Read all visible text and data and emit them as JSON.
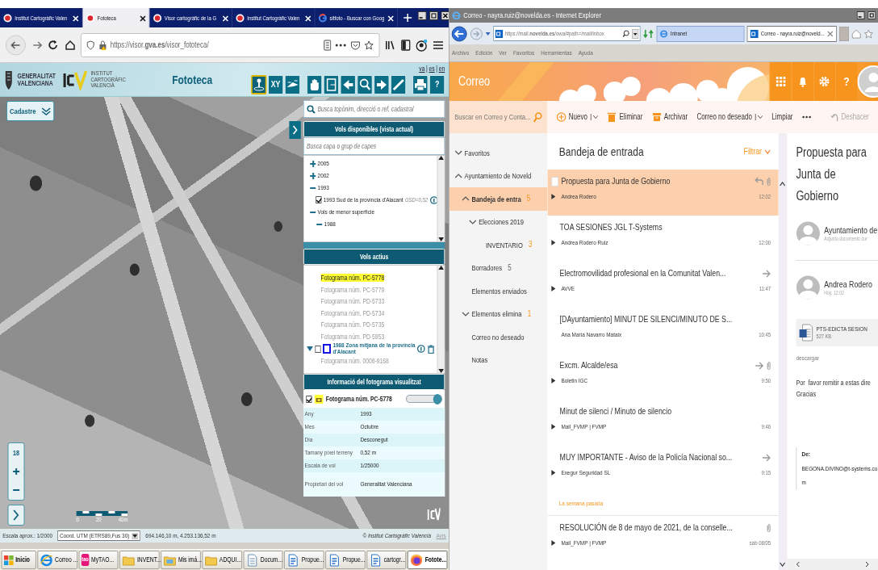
{
  "firefox": {
    "tabs": [
      {
        "title": "Institut Cartogràfic Valen",
        "selected": false
      },
      {
        "title": "Fototeca",
        "selected": true
      },
      {
        "title": "Visor cartogràfic de la G",
        "selected": false
      },
      {
        "title": "Institut Cartogràfic Valen",
        "selected": false
      },
      {
        "title": "sitfoto - Buscar con Goog",
        "selected": false
      }
    ],
    "url": "https://visor.**gva.es**/visor_fototeca/"
  },
  "visor": {
    "agency": "GENERALITAT VALENCIANA",
    "institute": "INSTITUT CARTOGRÀFIC VALENCIÀ",
    "title": "Fototeca",
    "languages": [
      "va",
      "es",
      "en"
    ],
    "language_separator": "|",
    "tools": [
      {
        "kind": "pin",
        "selected": true
      },
      {
        "kind": "xy",
        "label": "XY",
        "selected": false
      },
      {
        "kind": "plane",
        "selected": false
      },
      {
        "kind": "hand",
        "selected": false,
        "group_start": true
      },
      {
        "kind": "door",
        "selected": false
      },
      {
        "kind": "back",
        "selected": false
      },
      {
        "kind": "zoom",
        "selected": false
      },
      {
        "kind": "forward",
        "selected": false
      },
      {
        "kind": "ruler",
        "selected": false
      },
      {
        "kind": "print",
        "selected": false,
        "group_start": true
      },
      {
        "kind": "help",
        "label": "?",
        "selected": false
      }
    ],
    "basemap": "Cadastre",
    "search_placeholder": "Busca topònim, direcció o ref. cadastral",
    "layers": {
      "title": "Vols disponibles (vista actual)",
      "placeholder": "Busca capa o grup de capes",
      "tree": [
        {
          "label": "2005",
          "expanded": false
        },
        {
          "label": "2002",
          "expanded": false
        },
        {
          "label": "1993",
          "expanded": true,
          "children": [
            {
              "label": "1993 Sud de la província d'Alacant",
              "checked": true,
              "gsd": "GSD=0,52"
            }
          ]
        },
        {
          "label": "Vols de menor superfície",
          "expanded": true,
          "children": [
            {
              "label": "1988",
              "expanded": true
            }
          ]
        }
      ]
    },
    "active": {
      "title": "Vols actius",
      "photos": [
        {
          "label": "Fotograma núm. PC-5778",
          "selected": true
        },
        {
          "label": "Fotograma núm. PC-5779",
          "selected": false
        },
        {
          "label": "Fotograma núm. PD-5733",
          "selected": false
        },
        {
          "label": "Fotograma núm. PD-5734",
          "selected": false
        },
        {
          "label": "Fotograma núm. PD-5735",
          "selected": false
        },
        {
          "label": "Fotograma núm. PD-5953",
          "selected": false
        }
      ],
      "group": {
        "label": "1988 Zona mitjana de la província d'Alacant",
        "expanded": true,
        "checked": false,
        "photos": [
          {
            "label": "Fotograma núm. 0008-9168",
            "selected": false
          }
        ]
      }
    },
    "info": {
      "title": "Informació del fotograma visualitzat",
      "photo": "Fotograma núm. PC-5778",
      "checked": true,
      "opacity": {
        "level": 1
      },
      "rows": [
        {
          "label": "Any",
          "value": "1993"
        },
        {
          "label": "Mes",
          "value": "Octubre"
        },
        {
          "label": "Dia",
          "value": "Desconegut"
        },
        {
          "label": "Tamany píxel terreny",
          "value": "0,52 m"
        },
        {
          "label": "Escala de vol",
          "value": "1/25000"
        },
        {
          "label": "Propietari del vol",
          "value": "Generalitat Valenciana"
        }
      ]
    },
    "zoom_level": "18",
    "scale_bar": [
      "0",
      "20",
      "40m"
    ],
    "status": {
      "scale": "Escala aprox.: 1/2000",
      "coord_system": "Coord. UTM (ETRS89,Fus 30)",
      "coords": "694.146,10 m, 4.253.136,52 m",
      "copyright": "© Institut Cartogràfic Valencià",
      "link": "Avís"
    }
  },
  "taskbar": {
    "start": "Inicio",
    "items": [
      {
        "kind": "browser",
        "label": "Correo ...",
        "selected": false
      },
      {
        "kind": "app",
        "label": "MyTAO...",
        "badge": "tao",
        "selected": false
      },
      {
        "kind": "folder",
        "label": "INVENT...",
        "selected": false
      },
      {
        "kind": "pictures",
        "label": "Mis imá...",
        "selected": false
      },
      {
        "kind": "folder",
        "label": "ADQUI...",
        "selected": false
      },
      {
        "kind": "document",
        "label": "Docum...",
        "selected": false
      },
      {
        "kind": "writer",
        "label": "Propue...",
        "selected": false
      },
      {
        "kind": "writer",
        "label": "Propue...",
        "selected": false
      },
      {
        "kind": "writer",
        "label": "cartogr...",
        "selected": false
      },
      {
        "kind": "firefox",
        "label": "Fotote...",
        "selected": true
      }
    ]
  },
  "ie": {
    "title": "Correo - nayra.ruiz@novelda.es - Internet Explorer",
    "url": "https://mail.**novelda.es**/owa/#path=/mail/inbox",
    "tabs": [
      {
        "title": "Intranet",
        "selected": false
      },
      {
        "title": "Correo - nayra.ruiz@noveld...",
        "selected": true
      }
    ],
    "menu": [
      "Archivo",
      "Edición",
      "Ver",
      "Favoritos",
      "Herramientas",
      "Ayuda"
    ]
  },
  "owa": {
    "app": "Correo",
    "help": "?",
    "search_placeholder": "Buscar en Correo y Conta...",
    "toolbar": [
      {
        "kind": "new",
        "label": "Nuevo",
        "dropdown": true
      },
      {
        "kind": "delete",
        "label": "Eliminar"
      },
      {
        "kind": "archive",
        "label": "Archivar"
      },
      {
        "kind": "junk",
        "label": "Correo no deseado",
        "dropdown": true
      },
      {
        "kind": "sweep",
        "label": "Limpiar"
      },
      {
        "kind": "more"
      }
    ],
    "undo": "Deshacer",
    "folders": [
      {
        "label": "Favoritos",
        "expanded": false,
        "selected": false
      },
      {
        "label": "Ayuntamiento de Noveld",
        "expanded": true,
        "selected": false,
        "children": [
          {
            "label": "Bandeja de entra",
            "count": "5",
            "unread": true,
            "expanded": true,
            "selected": true,
            "children": [
              {
                "label": "Elecciones 2019",
                "expanded": false,
                "selected": false,
                "children": [
                  {
                    "label": "INVENTARIO",
                    "count": "3",
                    "unread": true,
                    "selected": false
                  }
                ]
              }
            ]
          },
          {
            "label": "Borradores",
            "count": "5",
            "unread": false,
            "selected": false
          },
          {
            "label": "Elementos enviados",
            "selected": false
          },
          {
            "label": "Elementos elimina",
            "count": "1",
            "unread": true,
            "expanded": false,
            "selected": false
          },
          {
            "label": "Correo no deseado",
            "selected": false
          },
          {
            "label": "Notas",
            "selected": false
          }
        ]
      }
    ],
    "list_title": "Bandeja de entrada",
    "filter": "Filtrar",
    "messages": [
      {
        "kind": "message",
        "subject": "Propuesta para Junta de Gobierno",
        "sender": "Andrea Rodero",
        "time": "12:02",
        "selected": true,
        "conversation": true,
        "replied": true,
        "attachment": true
      },
      {
        "kind": "message",
        "subject": "TOA SESIONES JGL T-Systems",
        "sender": "Andrea Rodero Ruiz",
        "time": "12:00",
        "selected": false,
        "conversation": true
      },
      {
        "kind": "message",
        "subject": "Electromovilidad profesional en la Comunitat Valen...",
        "sender": "AVVE",
        "time": "11:47",
        "selected": false,
        "conversation": true,
        "forwarded": true
      },
      {
        "kind": "message",
        "subject": "[DAyuntamiento] MINUT DE SILENCI/MINUTO DE S...",
        "sender": "Ana María Navarro Mataix",
        "time": "10:45",
        "selected": false,
        "conversation": false
      },
      {
        "kind": "message",
        "subject": "Excm. Alcalde/esa",
        "sender": "Boletin IGC",
        "time": "9:50",
        "selected": false,
        "conversation": true,
        "forwarded": true,
        "attachment": true
      },
      {
        "kind": "message",
        "subject": "Minut de silenci / Minuto de silencio",
        "sender": "Mail_FVMP | FVMP",
        "time": "9:46",
        "selected": false,
        "conversation": true
      },
      {
        "kind": "message",
        "subject": "MUY IMPORTANTE - Aviso de la Policía Nacional so...",
        "sender": "Exegur Seguridad SL",
        "time": "9:15",
        "selected": false,
        "conversation": true,
        "forwarded": true
      },
      {
        "kind": "section",
        "label": "La semana pasada"
      },
      {
        "kind": "message",
        "subject": "RESOLUCIÓN de 8 de mayo de 2021, de la conselle...",
        "sender": "Mail_FVMP | FVMP",
        "time": "sáb 08/05",
        "selected": false,
        "conversation": true,
        "attachment": true
      }
    ],
    "reading": {
      "subject": "Propuesta para Junta de Gobierno",
      "senders": [
        {
          "name": "Ayuntamiento de",
          "detail": "Adjunto documento cur"
        },
        {
          "name": "Andrea Rodero",
          "detail": "Hoy, 12:02"
        }
      ],
      "attachment": {
        "name": "PTS-EDICTA SESION",
        "size": "527 KB"
      },
      "download": "descargar",
      "body": [
        "Por  favor remitir a estas dire",
        "Gracias"
      ],
      "quote": {
        "label": "De:",
        "value": "BEGONA.DIVINO@t-systems.com"
      }
    }
  }
}
